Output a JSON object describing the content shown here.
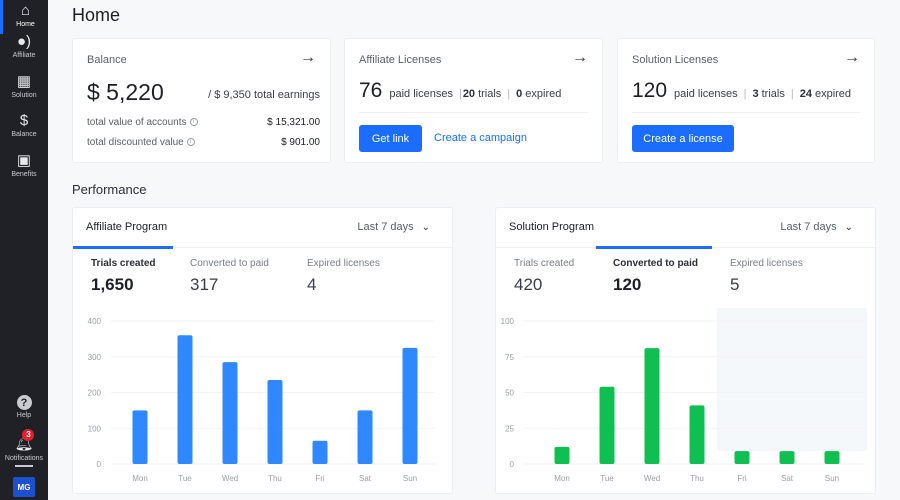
{
  "sidebar": {
    "items": [
      {
        "label": "Home",
        "icon": "home-icon",
        "active": true
      },
      {
        "label": "Affiliate",
        "icon": "affiliate-icon"
      },
      {
        "label": "Solution",
        "icon": "building-icon"
      },
      {
        "label": "Balance",
        "icon": "dollar-icon"
      },
      {
        "label": "Benefits",
        "icon": "ticket-star-icon"
      }
    ],
    "help_label": "Help",
    "notifications_label": "Notifications",
    "notifications_count": "3",
    "avatar_initials": "MG"
  },
  "page": {
    "title": "Home"
  },
  "balance": {
    "title": "Balance",
    "amount": "$ 5,220",
    "total_earnings": "/ $ 9,350 total earnings",
    "rows": [
      {
        "label": "total value of accounts",
        "value": "$ 15,321.00"
      },
      {
        "label": "total discounted value",
        "value": "$ 901.00"
      }
    ]
  },
  "affiliate_licenses": {
    "title": "Affiliate Licenses",
    "paid": "76",
    "paid_label": "paid licenses",
    "trials": "20",
    "trials_label": "trials",
    "expired": "0",
    "expired_label": "expired",
    "button": "Get link",
    "link": "Create a campaign"
  },
  "solution_licenses": {
    "title": "Solution Licenses",
    "paid": "120",
    "paid_label": "paid licenses",
    "trials": "3",
    "trials_label": "trials",
    "expired": "24",
    "expired_label": "expired",
    "button": "Create a license"
  },
  "performance": {
    "title": "Performance",
    "affiliate": {
      "title": "Affiliate Program",
      "period": "Last 7 days",
      "active_stat": 0,
      "stats": [
        {
          "label": "Trials created",
          "value": "1,650"
        },
        {
          "label": "Converted to paid",
          "value": "317"
        },
        {
          "label": "Expired licenses",
          "value": "4"
        }
      ]
    },
    "solution": {
      "title": "Solution Program",
      "period": "Last 7 days",
      "active_stat": 1,
      "stats": [
        {
          "label": "Trials created",
          "value": "420"
        },
        {
          "label": "Converted to paid",
          "value": "120"
        },
        {
          "label": "Expired licenses",
          "value": "5"
        }
      ]
    }
  },
  "colors": {
    "accent": "#1a6dff",
    "affiliate_bar": "#2f88ff",
    "solution_bar": "#0fbf52"
  },
  "chart_data": [
    {
      "type": "bar",
      "title": "Affiliate Program - Trials created",
      "categories": [
        "Mon",
        "Tue",
        "Wed",
        "Thu",
        "Fri",
        "Sat",
        "Sun"
      ],
      "values": [
        150,
        360,
        285,
        235,
        65,
        150,
        325
      ],
      "yticks": [
        0,
        100,
        200,
        300,
        400
      ],
      "ylim": [
        0,
        400
      ],
      "grid": true,
      "xlabel": "",
      "ylabel": ""
    },
    {
      "type": "bar",
      "title": "Solution Program - Converted to paid",
      "categories": [
        "Mon",
        "Tue",
        "Wed",
        "Thu",
        "Fri",
        "Sat",
        "Sun"
      ],
      "values": [
        12,
        54,
        81,
        41,
        9,
        9,
        9
      ],
      "yticks": [
        0,
        25,
        50,
        75,
        100
      ],
      "ylim": [
        0,
        100
      ],
      "grid": true,
      "xlabel": "",
      "ylabel": ""
    }
  ]
}
